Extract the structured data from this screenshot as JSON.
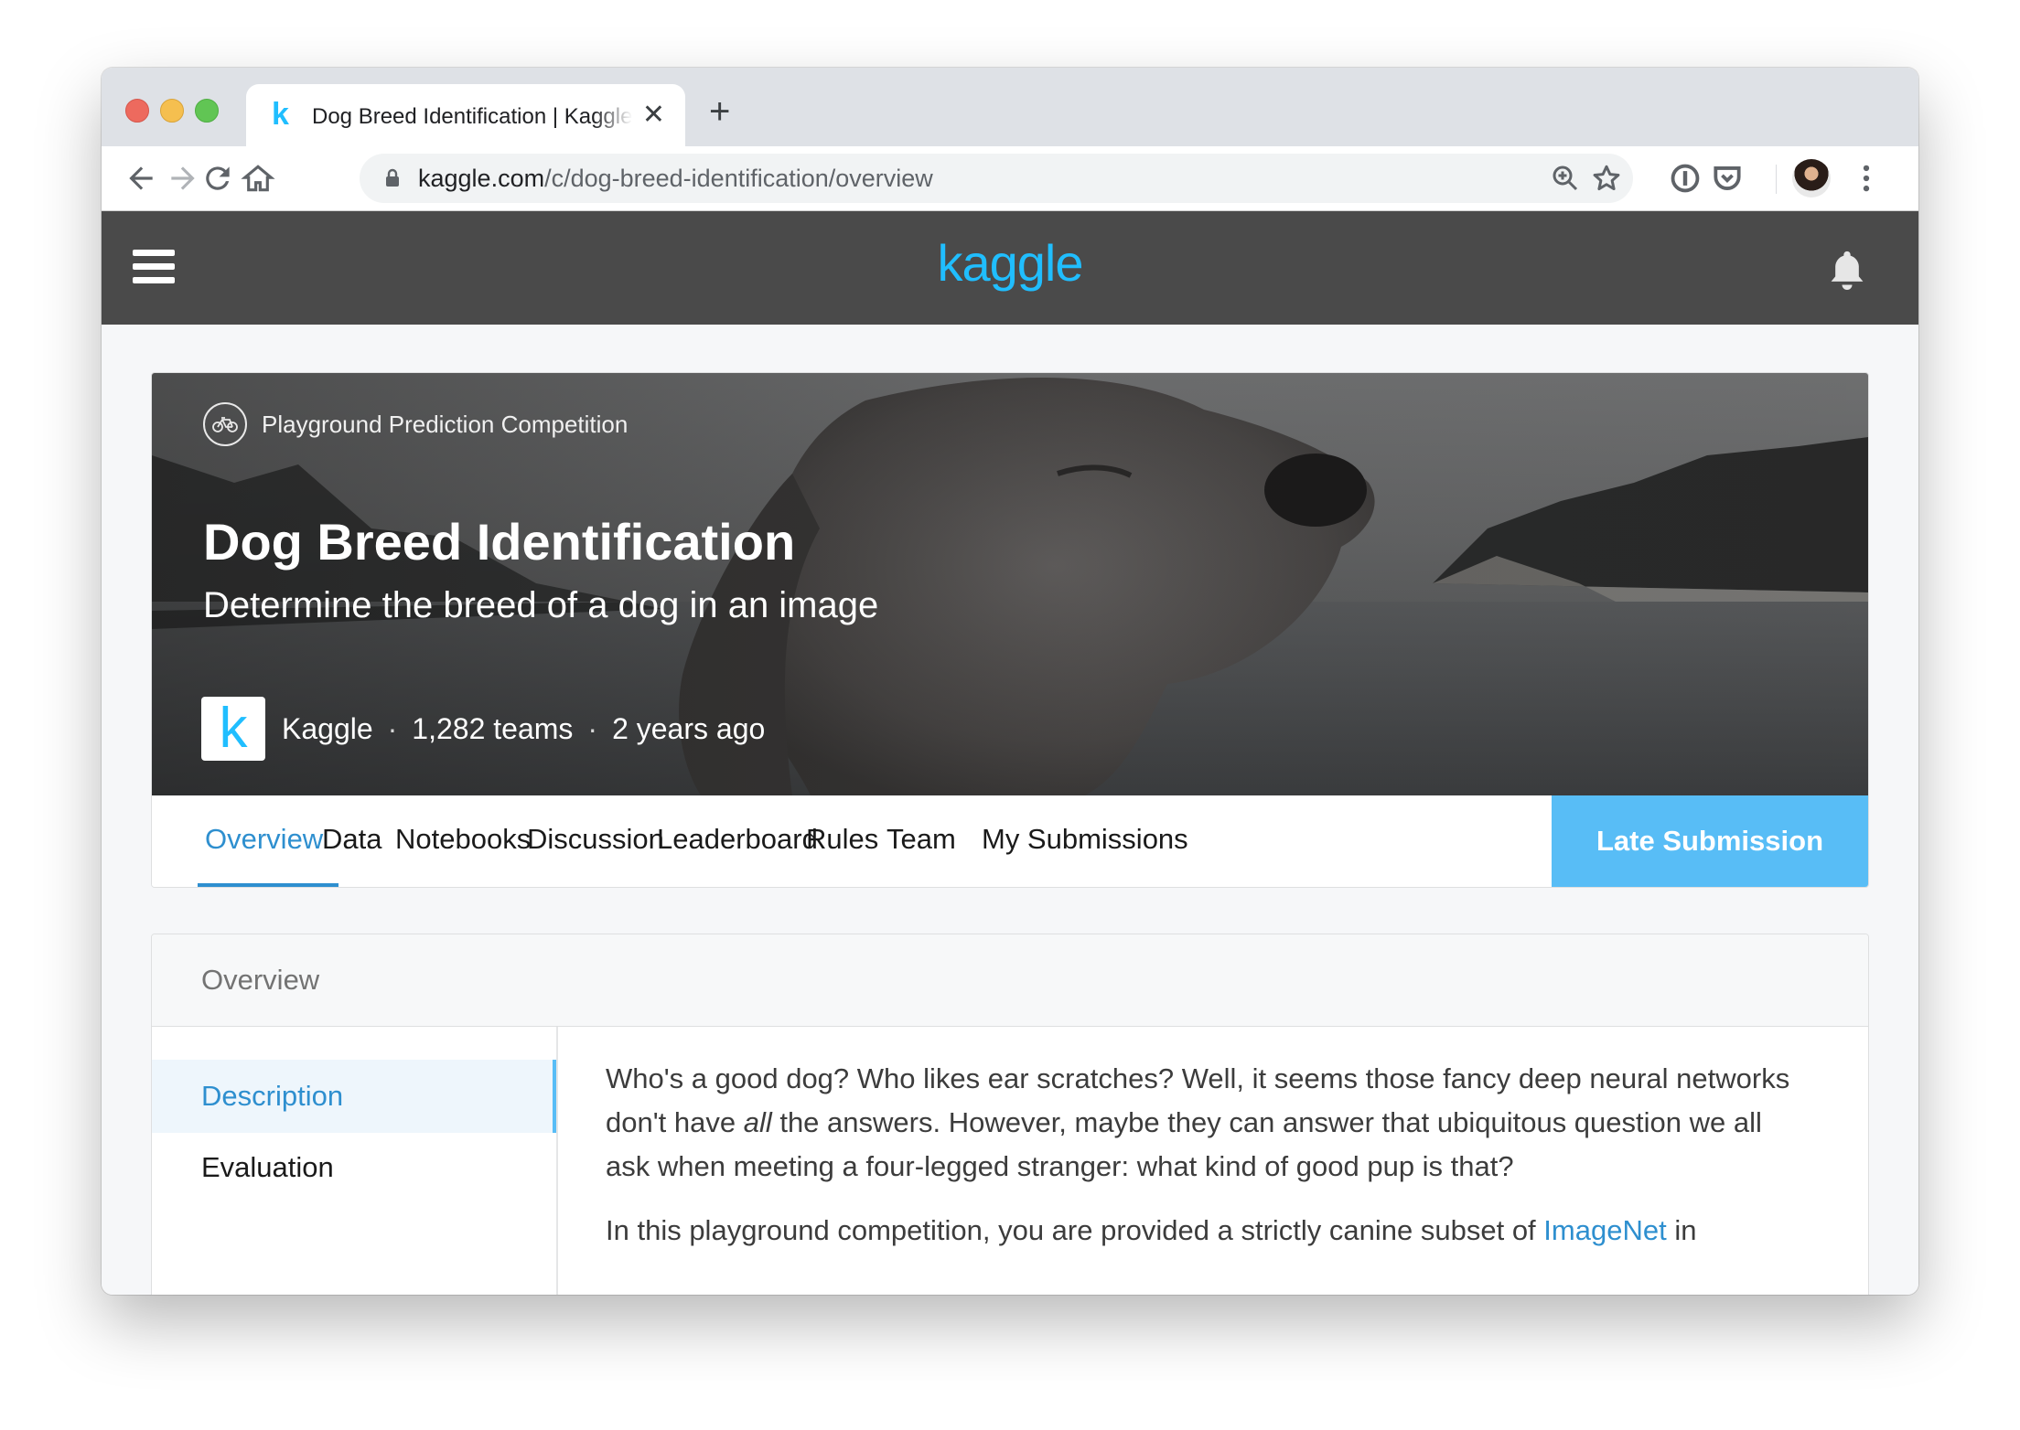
{
  "browser": {
    "tab_title": "Dog Breed Identification | Kaggle",
    "tab_favicon": "k",
    "new_tab_label": "+",
    "close_label": "✕",
    "url_host": "kaggle.com",
    "url_path": "/c/dog-breed-identification/overview"
  },
  "header": {
    "logo": "kaggle"
  },
  "competition": {
    "type": "Playground Prediction Competition",
    "title": "Dog Breed Identification",
    "subtitle": "Determine the breed of a dog in an image",
    "host_logo": "k",
    "host": "Kaggle",
    "teams": "1,282 teams",
    "age": "2 years ago",
    "separator": "·"
  },
  "tabs": [
    {
      "label": "Overview",
      "active": true
    },
    {
      "label": "Data"
    },
    {
      "label": "Notebooks"
    },
    {
      "label": "Discussion"
    },
    {
      "label": "Leaderboard"
    },
    {
      "label": "Rules"
    },
    {
      "label": "Team"
    },
    {
      "label": "My Submissions"
    }
  ],
  "late_submission_label": "Late Submission",
  "overview": {
    "heading": "Overview",
    "side_items": [
      {
        "label": "Description",
        "active": true
      },
      {
        "label": "Evaluation"
      }
    ],
    "para1_a": "Who's a good dog? Who likes ear scratches? Well, it seems those fancy deep neural networks don't have ",
    "para1_em": "all",
    "para1_b": " the answers. However, maybe they can answer that ubiquitous question we all ask when meeting a four-legged stranger: what kind of good pup is that?",
    "para2_a": "In this playground competition, you are provided a strictly canine subset of ",
    "para2_link": "ImageNet",
    "para2_b": " in"
  },
  "colors": {
    "accent": "#20beff",
    "link": "#2e8fcf",
    "late_button": "#58bdf6",
    "header_bg": "#4a4a4a"
  },
  "icons": [
    "back-icon",
    "forward-icon",
    "reload-icon",
    "home-icon",
    "lock-icon",
    "zoom-icon",
    "star-icon",
    "extension-icon",
    "pocket-icon",
    "menu-icon",
    "hamburger-icon",
    "bell-icon",
    "bike-icon"
  ]
}
